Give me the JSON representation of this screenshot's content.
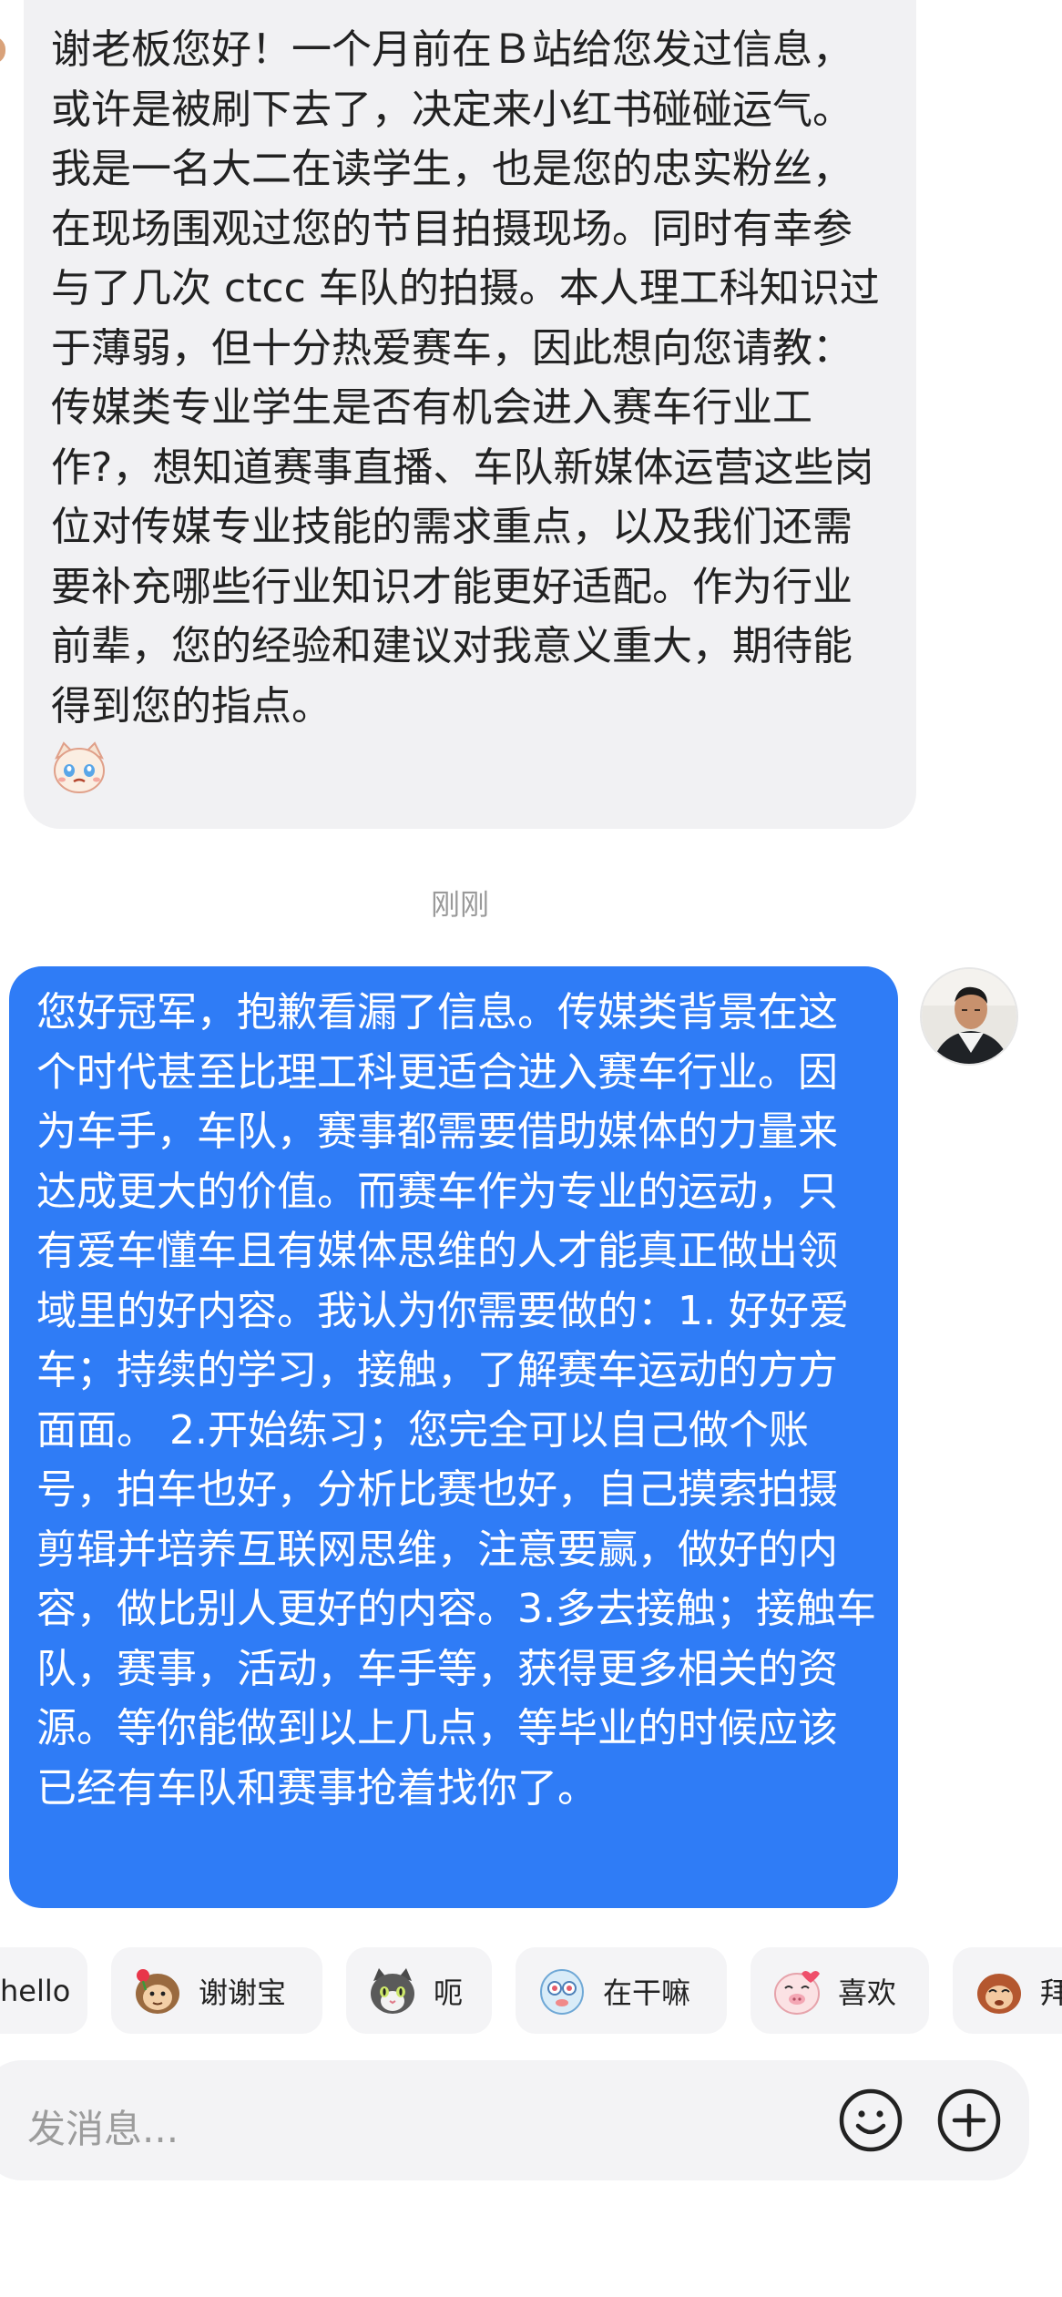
{
  "incoming_message": {
    "text": "谢老板您好！一个月前在Ｂ站给您发过信息，或许是被刷下去了，决定来小红书碰碰运气。我是一名大二在读学生，也是您的忠实粉丝，在现场围观过您的节目拍摄现场。同时有幸参与了几次 ctcc 车队的拍摄。本人理工科知识过于薄弱，但十分热爱赛车，因此想向您请教：传媒类专业学生是否有机会进入赛车行业工作?，想知道赛事直播、车队新媒体运营这些岗位对传媒专业技能的需求重点，以及我们还需要补充哪些行业知识才能更好适配。作为行业前辈，您的经验和建议对我意义重大，期待能得到您的指点。",
    "emoji": "crying-cat-sticker"
  },
  "timestamp": "刚刚",
  "outgoing_message": {
    "text": "您好冠军，抱歉看漏了信息。传媒类背景在这个时代甚至比理工科更适合进入赛车行业。因为车手，车队，赛事都需要借助媒体的力量来达成更大的价值。而赛车作为专业的运动，只有爱车懂车且有媒体思维的人才能真正做出领域里的好内容。我认为你需要做的：1. 好好爱车；持续的学习，接触，了解赛车运动的方方面面。 2.开始练习；您完全可以自己做个账号，拍车也好，分析比赛也好，自己摸索拍摄剪辑并培养互联网思维，注意要赢，做好的内容，做比别人更好的内容。3.多去接触；接触车队，赛事，活动，车手等，获得更多相关的资源。等你能做到以上几点，等毕业的时候应该已经有车队和赛事抢着找你了。"
  },
  "quick_replies": [
    {
      "label": "hello",
      "icon": "none"
    },
    {
      "label": "谢谢宝",
      "icon": "monkey-rose-sticker"
    },
    {
      "label": "呃",
      "icon": "cat-sticker"
    },
    {
      "label": "在干嘛",
      "icon": "blue-creature-sticker"
    },
    {
      "label": "喜欢",
      "icon": "pink-pig-sticker"
    },
    {
      "label": "拜",
      "icon": "monkey-sticker"
    }
  ],
  "input": {
    "placeholder": "发消息..."
  },
  "colors": {
    "outgoing_bubble": "#2f7cf6",
    "incoming_bubble": "#f1f1f3",
    "chip_bg": "#f4f4f6"
  }
}
